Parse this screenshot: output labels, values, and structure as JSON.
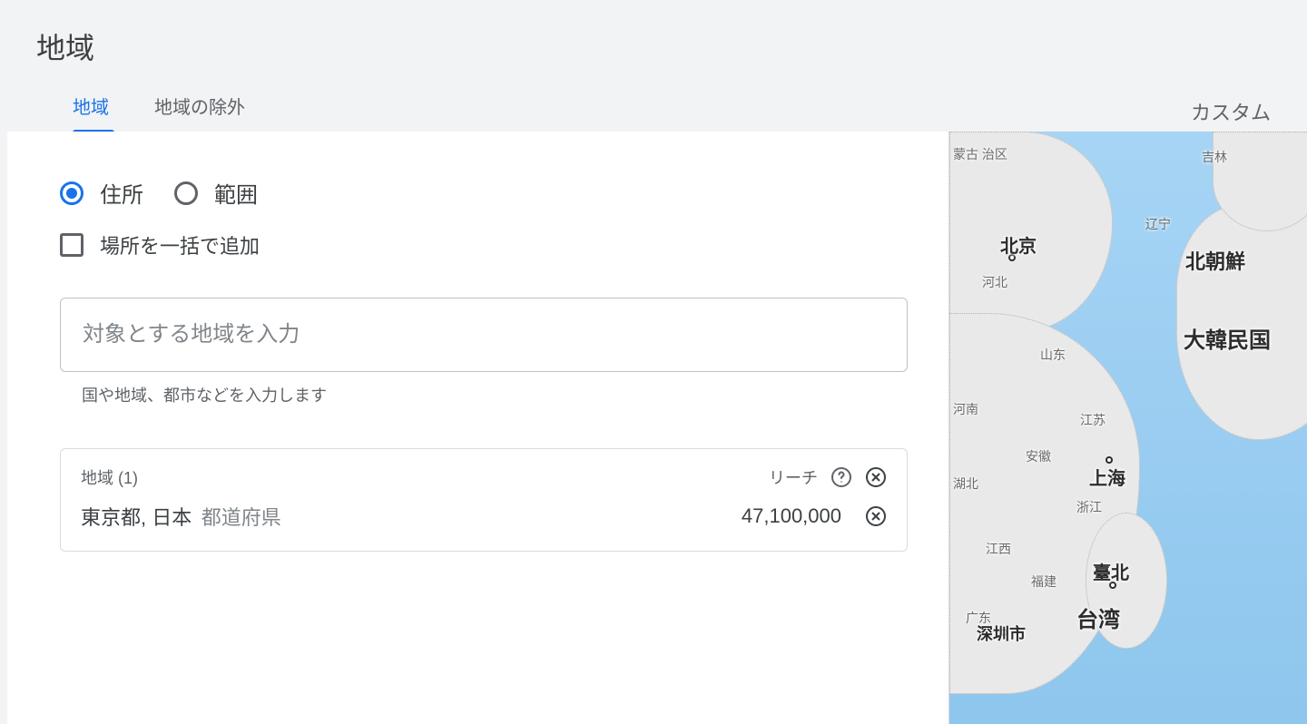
{
  "page": {
    "title": "地域",
    "custom_link": "カスタム"
  },
  "tabs": {
    "locations": "地域",
    "excluded": "地域の除外"
  },
  "form": {
    "radio_address": "住所",
    "radio_radius": "範囲",
    "bulk_add_label": "場所を一括で追加",
    "search_placeholder": "対象とする地域を入力",
    "helper": "国や地域、都市などを入力します"
  },
  "locations_card": {
    "header": "地域 (1)",
    "reach_label": "リーチ",
    "items": [
      {
        "name": "東京都, 日本",
        "type": "都道府県",
        "reach": "47,100,000"
      }
    ]
  },
  "map": {
    "labels": {
      "mongolia": "蒙古\n治区",
      "jilin": "吉林",
      "liaoning": "辽宁",
      "north_korea": "北朝鮮",
      "south_korea": "大韓民国",
      "beijing": "北京",
      "hebei": "河北",
      "shandong": "山东",
      "henan": "河南",
      "anhui": "安徽",
      "jiangsu": "江苏",
      "shanghai": "上海",
      "zhejiang": "浙江",
      "jiangxi": "江西",
      "hubei": "湖北",
      "fujian": "福建",
      "guangdong": "广东",
      "shenzhen": "深圳市",
      "taipei": "臺北",
      "taiwan": "台湾"
    }
  }
}
